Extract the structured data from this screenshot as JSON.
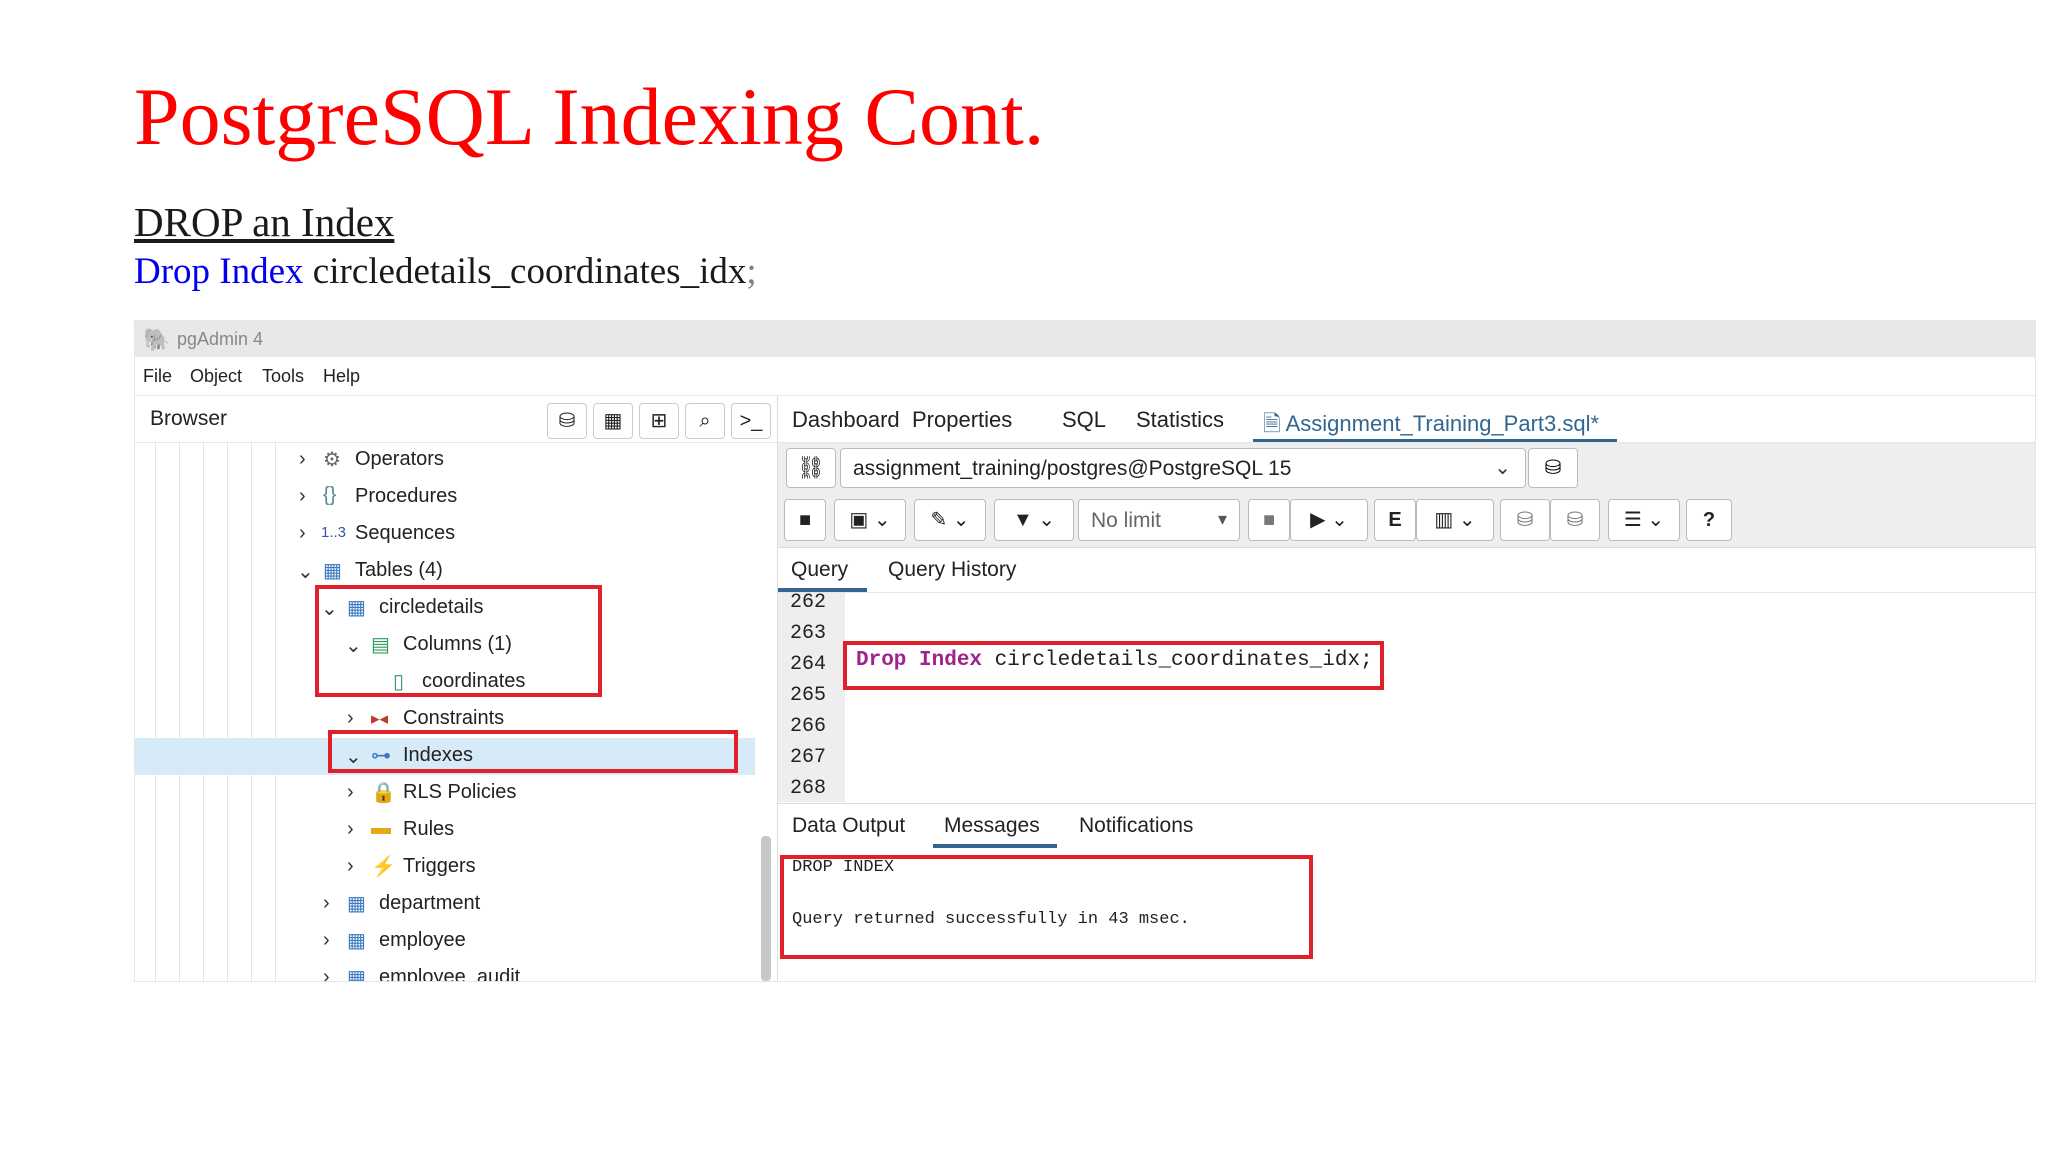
{
  "slide": {
    "title": "PostgreSQL Indexing Cont.",
    "subtitle": "DROP an Index",
    "code_keyword": "Drop Index",
    "code_rest": " circledetails_coordinates_idx",
    "code_semicolon": ";"
  },
  "app": {
    "title": "pgAdmin 4",
    "menu": [
      "File",
      "Object",
      "Tools",
      "Help"
    ]
  },
  "browser": {
    "title": "Browser",
    "tree": [
      {
        "label": "Operators",
        "icon": "operators-icon",
        "expanded": false
      },
      {
        "label": "Procedures",
        "icon": "procedures-icon",
        "expanded": false
      },
      {
        "label": "Sequences",
        "icon": "sequences-icon",
        "expanded": false,
        "icon_text": "1..3"
      },
      {
        "label": "Tables (4)",
        "icon": "tables-icon",
        "expanded": true
      },
      {
        "label": "circledetails",
        "icon": "table-icon",
        "expanded": true
      },
      {
        "label": "Columns (1)",
        "icon": "columns-icon",
        "expanded": true
      },
      {
        "label": "coordinates",
        "icon": "column-icon"
      },
      {
        "label": "Constraints",
        "icon": "constraints-icon",
        "expanded": false
      },
      {
        "label": "Indexes",
        "icon": "indexes-icon",
        "expanded": true,
        "selected": true
      },
      {
        "label": "RLS Policies",
        "icon": "rls-policies-icon",
        "expanded": false
      },
      {
        "label": "Rules",
        "icon": "rules-icon",
        "expanded": false
      },
      {
        "label": "Triggers",
        "icon": "triggers-icon",
        "expanded": false
      },
      {
        "label": "department",
        "icon": "table-icon",
        "expanded": false
      },
      {
        "label": "employee",
        "icon": "table-icon",
        "expanded": false
      },
      {
        "label": "employee_audit",
        "icon": "table-icon",
        "expanded": false
      }
    ]
  },
  "main": {
    "tabs": [
      "Dashboard",
      "Properties",
      "SQL",
      "Statistics",
      "Assignment_Training_Part3.sql*"
    ],
    "connection": "assignment_training/postgres@PostgreSQL 15",
    "limit": "No limit",
    "editor_tabs": [
      "Query",
      "Query History"
    ],
    "line_numbers": [
      "262",
      "263",
      "264",
      "265",
      "266",
      "267",
      "268"
    ],
    "sql_keyword": "Drop Index",
    "sql_rest": " circledetails_coordinates_idx;",
    "output_tabs": [
      "Data Output",
      "Messages",
      "Notifications"
    ],
    "messages": [
      "DROP INDEX",
      "Query returned successfully in 43 msec."
    ]
  },
  "colors": {
    "title": "#ff0000",
    "keyword": "#0000ee",
    "accent": "#326690",
    "highlight": "#e0202a",
    "sql_keyword": "#a0228e"
  }
}
